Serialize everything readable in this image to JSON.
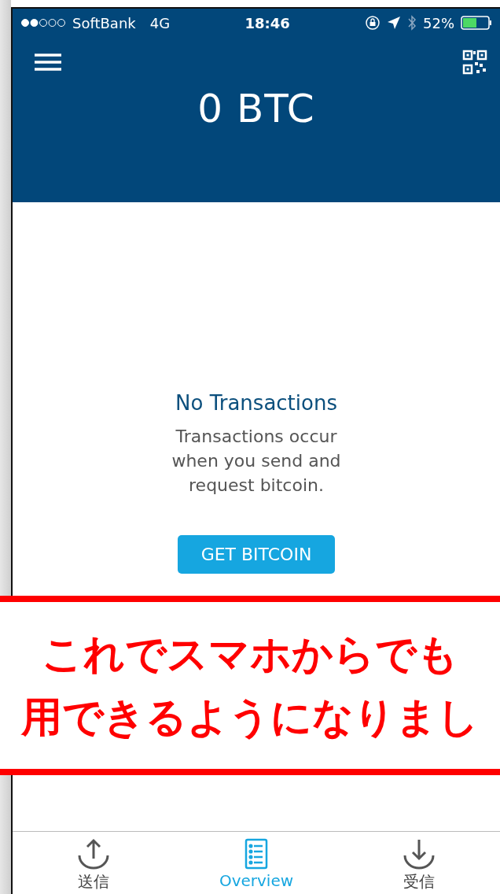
{
  "status_bar": {
    "carrier": "SoftBank",
    "network": "4G",
    "time": "18:46",
    "battery": "52%"
  },
  "header": {
    "balance": "0 BTC"
  },
  "empty_state": {
    "title": "No Transactions",
    "message": "Transactions occur when you send and request bitcoin.",
    "button": "GET BITCOIN"
  },
  "annotation": {
    "lines": [
      "これでスマホからでも",
      "用できるようになりまし"
    ]
  },
  "tab_bar": [
    {
      "label": "送信",
      "kind": "send",
      "selected": false
    },
    {
      "label": "Overview",
      "kind": "overview",
      "selected": true
    },
    {
      "label": "受信",
      "kind": "receive",
      "selected": false
    }
  ]
}
